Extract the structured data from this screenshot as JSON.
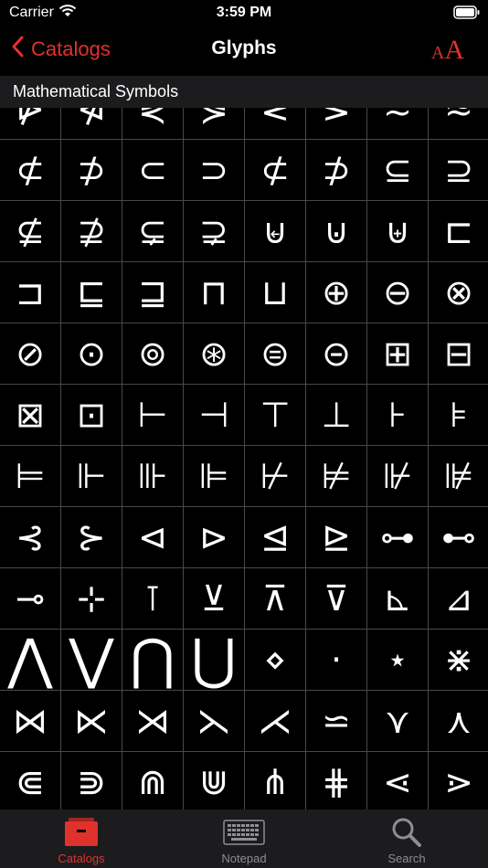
{
  "status": {
    "carrier": "Carrier",
    "time": "3:59 PM"
  },
  "nav": {
    "back_label": "Catalogs",
    "title": "Glyphs",
    "font_button_small": "A",
    "font_button_large": "A"
  },
  "section": {
    "title": "Mathematical Symbols"
  },
  "glyphs": [
    "⋫",
    "⋪",
    "⋞",
    "⋟",
    "⋜",
    "⋝",
    "≂",
    "≈",
    "⊄",
    "⊅",
    "⊂",
    "⊃",
    "⊄",
    "⊅",
    "⊆",
    "⊇",
    "⊈",
    "⊉",
    "⊊",
    "⊋",
    "⊌",
    "⊍",
    "⊎",
    "⊏",
    "⊐",
    "⊑",
    "⊒",
    "⊓",
    "⊔",
    "⊕",
    "⊖",
    "⊗",
    "⊘",
    "⊙",
    "⊚",
    "⊛",
    "⊜",
    "⊝",
    "⊞",
    "⊟",
    "⊠",
    "⊡",
    "⊢",
    "⊣",
    "⊤",
    "⊥",
    "⊦",
    "⊧",
    "⊨",
    "⊩",
    "⊪",
    "⊫",
    "⊬",
    "⊭",
    "⊮",
    "⊯",
    "⊰",
    "⊱",
    "⊲",
    "⊳",
    "⊴",
    "⊵",
    "⊶",
    "⊷",
    "⊸",
    "⊹",
    "⊺",
    "⊻",
    "⊼",
    "⊽",
    "⊾",
    "⊿",
    "⋀",
    "⋁",
    "⋂",
    "⋃",
    "⋄",
    "⋅",
    "⋆",
    "⋇",
    "⋈",
    "⋉",
    "⋊",
    "⋋",
    "⋌",
    "⋍",
    "⋎",
    "⋏",
    "⋐",
    "⋑",
    "⋒",
    "⋓",
    "⋔",
    "⋕",
    "⋖",
    "⋗"
  ],
  "tabs": [
    {
      "label": "Catalogs",
      "icon": "catalogs-icon",
      "active": true
    },
    {
      "label": "Notepad",
      "icon": "notepad-icon",
      "active": false
    },
    {
      "label": "Search",
      "icon": "search-icon",
      "active": false
    }
  ],
  "colors": {
    "accent": "#e0322d",
    "background": "#000000",
    "grid_line": "#48484a",
    "bar": "#1c1c1e"
  }
}
